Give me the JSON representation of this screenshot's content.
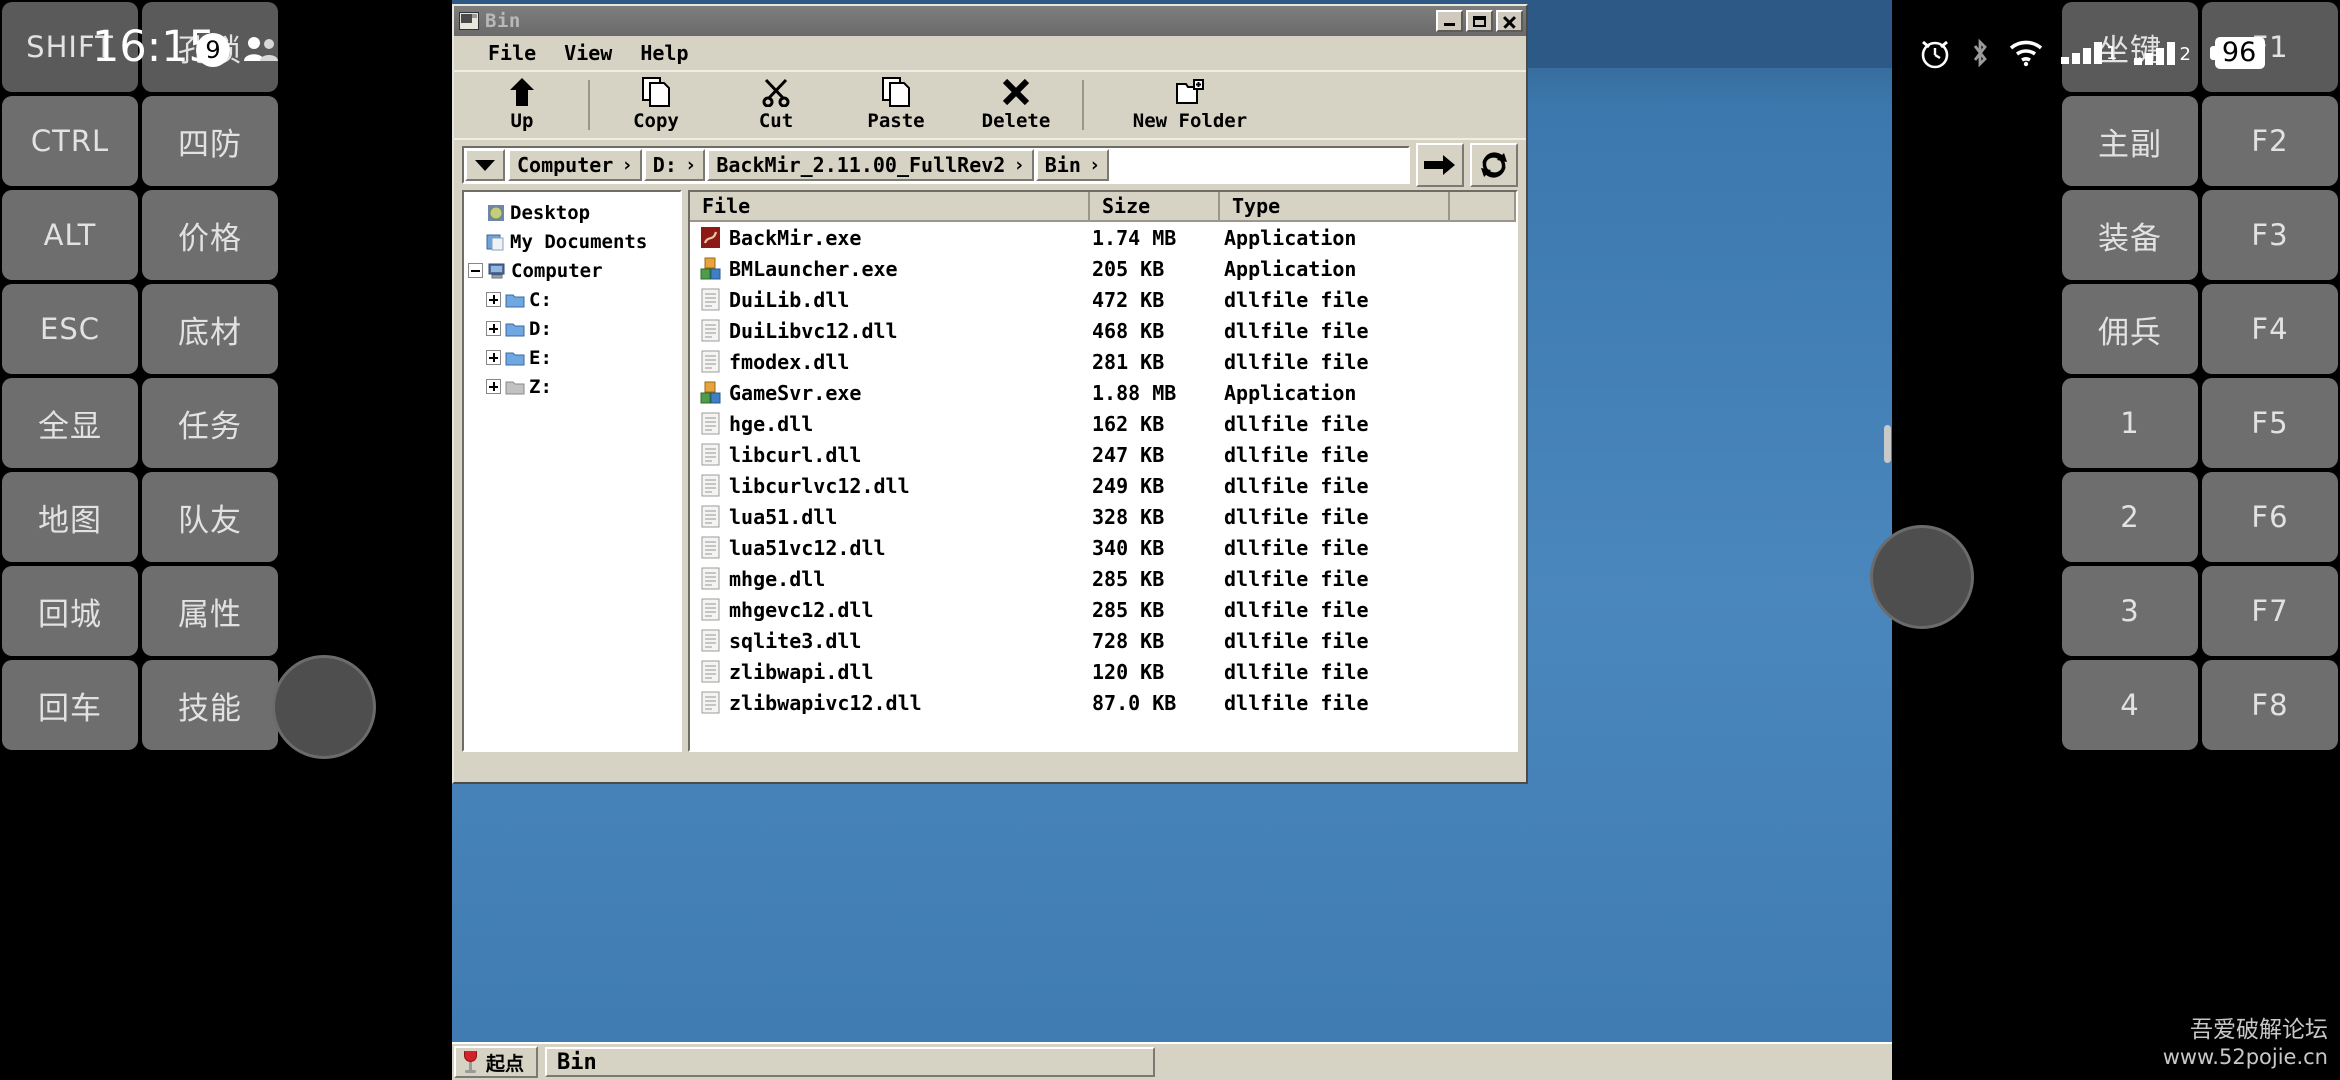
{
  "status_bar": {
    "time": "16:15",
    "notification_count": "9",
    "people_icon": "people-icon",
    "alarm_icon": "alarm-clock-icon",
    "bluetooth_icon": "bluetooth-icon",
    "wifi_icon": "wifi-icon",
    "signal1_label": "1",
    "signal2_label": "2",
    "battery_level": "96"
  },
  "gamepad_left": {
    "keys": [
      {
        "label": "SHIFT",
        "dim": true
      },
      {
        "label": "孔锁",
        "dim": true
      },
      {
        "label": "CTRL",
        "dim": false
      },
      {
        "label": "四防",
        "dim": false
      },
      {
        "label": "ALT",
        "dim": false
      },
      {
        "label": "价格",
        "dim": false
      },
      {
        "label": "ESC",
        "dim": false
      },
      {
        "label": "底材",
        "dim": false
      },
      {
        "label": "全显",
        "dim": false
      },
      {
        "label": "任务",
        "dim": false
      },
      {
        "label": "地图",
        "dim": false
      },
      {
        "label": "队友",
        "dim": false
      },
      {
        "label": "回城",
        "dim": false
      },
      {
        "label": "属性",
        "dim": false
      },
      {
        "label": "回车",
        "dim": false
      },
      {
        "label": "技能",
        "dim": false
      }
    ]
  },
  "gamepad_right": {
    "keys": [
      {
        "label": "坐键",
        "dim": true
      },
      {
        "label": "F1",
        "dim": true
      },
      {
        "label": "主副",
        "dim": false
      },
      {
        "label": "F2",
        "dim": false
      },
      {
        "label": "装备",
        "dim": false
      },
      {
        "label": "F3",
        "dim": false
      },
      {
        "label": "佣兵",
        "dim": false
      },
      {
        "label": "F4",
        "dim": false
      },
      {
        "label": "1",
        "dim": false
      },
      {
        "label": "F5",
        "dim": false
      },
      {
        "label": "2",
        "dim": false
      },
      {
        "label": "F6",
        "dim": false
      },
      {
        "label": "3",
        "dim": false
      },
      {
        "label": "F7",
        "dim": false
      },
      {
        "label": "4",
        "dim": false
      },
      {
        "label": "F8",
        "dim": false
      }
    ]
  },
  "window": {
    "title": "Bin",
    "app_icon": "folder-window-icon",
    "minimize_label": "minimize",
    "maximize_label": "maximize",
    "close_label": "close",
    "menu": [
      "File",
      "View",
      "Help"
    ],
    "toolbar": [
      {
        "label": "Up",
        "icon": "arrow-up-icon"
      },
      {
        "label": "Copy",
        "icon": "copy-icon"
      },
      {
        "label": "Cut",
        "icon": "scissors-icon"
      },
      {
        "label": "Paste",
        "icon": "paste-icon"
      },
      {
        "label": "Delete",
        "icon": "x-delete-icon"
      },
      {
        "label": "New Folder",
        "icon": "new-folder-icon"
      }
    ],
    "address": {
      "dropdown_icon": "chevron-down-icon",
      "crumbs": [
        "Computer",
        "D:",
        "BackMir_2.11.00_FullRev2",
        "Bin"
      ],
      "separator": "›",
      "go_icon": "arrow-right-icon",
      "refresh_icon": "refresh-icon"
    },
    "tree": [
      {
        "label": "Desktop",
        "indent": 1,
        "expander": "none",
        "icon": "desktop-icon"
      },
      {
        "label": "My Documents",
        "indent": 1,
        "expander": "none",
        "icon": "documents-icon"
      },
      {
        "label": "Computer",
        "indent": 0,
        "expander": "minus",
        "icon": "computer-icon"
      },
      {
        "label": "C:",
        "indent": 2,
        "expander": "plus",
        "icon": "drive-icon"
      },
      {
        "label": "D:",
        "indent": 2,
        "expander": "plus",
        "icon": "drive-icon"
      },
      {
        "label": "E:",
        "indent": 2,
        "expander": "plus",
        "icon": "drive-icon"
      },
      {
        "label": "Z:",
        "indent": 2,
        "expander": "plus",
        "icon": "drive-gray-icon"
      }
    ],
    "columns": [
      "File",
      "Size",
      "Type"
    ],
    "files": [
      {
        "name": "BackMir.exe",
        "size": "1.74 MB",
        "type": "Application",
        "icon": "app-red-icon"
      },
      {
        "name": "BMLauncher.exe",
        "size": "205 KB",
        "type": "Application",
        "icon": "app-blocks-icon"
      },
      {
        "name": "DuiLib.dll",
        "size": "472 KB",
        "type": "dllfile file",
        "icon": "dll-icon"
      },
      {
        "name": "DuiLibvc12.dll",
        "size": "468 KB",
        "type": "dllfile file",
        "icon": "dll-icon"
      },
      {
        "name": "fmodex.dll",
        "size": "281 KB",
        "type": "dllfile file",
        "icon": "dll-icon"
      },
      {
        "name": "GameSvr.exe",
        "size": "1.88 MB",
        "type": "Application",
        "icon": "app-blocks-icon"
      },
      {
        "name": "hge.dll",
        "size": "162 KB",
        "type": "dllfile file",
        "icon": "dll-icon"
      },
      {
        "name": "libcurl.dll",
        "size": "247 KB",
        "type": "dllfile file",
        "icon": "dll-icon"
      },
      {
        "name": "libcurlvc12.dll",
        "size": "249 KB",
        "type": "dllfile file",
        "icon": "dll-icon"
      },
      {
        "name": "lua51.dll",
        "size": "328 KB",
        "type": "dllfile file",
        "icon": "dll-icon"
      },
      {
        "name": "lua51vc12.dll",
        "size": "340 KB",
        "type": "dllfile file",
        "icon": "dll-icon"
      },
      {
        "name": "mhge.dll",
        "size": "285 KB",
        "type": "dllfile file",
        "icon": "dll-icon"
      },
      {
        "name": "mhgevc12.dll",
        "size": "285 KB",
        "type": "dllfile file",
        "icon": "dll-icon"
      },
      {
        "name": "sqlite3.dll",
        "size": "728 KB",
        "type": "dllfile file",
        "icon": "dll-icon"
      },
      {
        "name": "zlibwapi.dll",
        "size": "120 KB",
        "type": "dllfile file",
        "icon": "dll-icon"
      },
      {
        "name": "zlibwapivc12.dll",
        "size": "87.0 KB",
        "type": "dllfile file",
        "icon": "dll-icon"
      }
    ]
  },
  "taskbar": {
    "start_label": "起点",
    "start_icon": "wine-glass-icon",
    "tasks": [
      "Bin"
    ]
  },
  "watermark": {
    "line1": "吾爱破解论坛",
    "line2": "www.52pojie.cn"
  },
  "colors": {
    "desktop_blue": "#3f7bb0",
    "chrome": "#d6d2c4",
    "titlebar": "#6a6a6a",
    "key": "#6e6e6e"
  }
}
